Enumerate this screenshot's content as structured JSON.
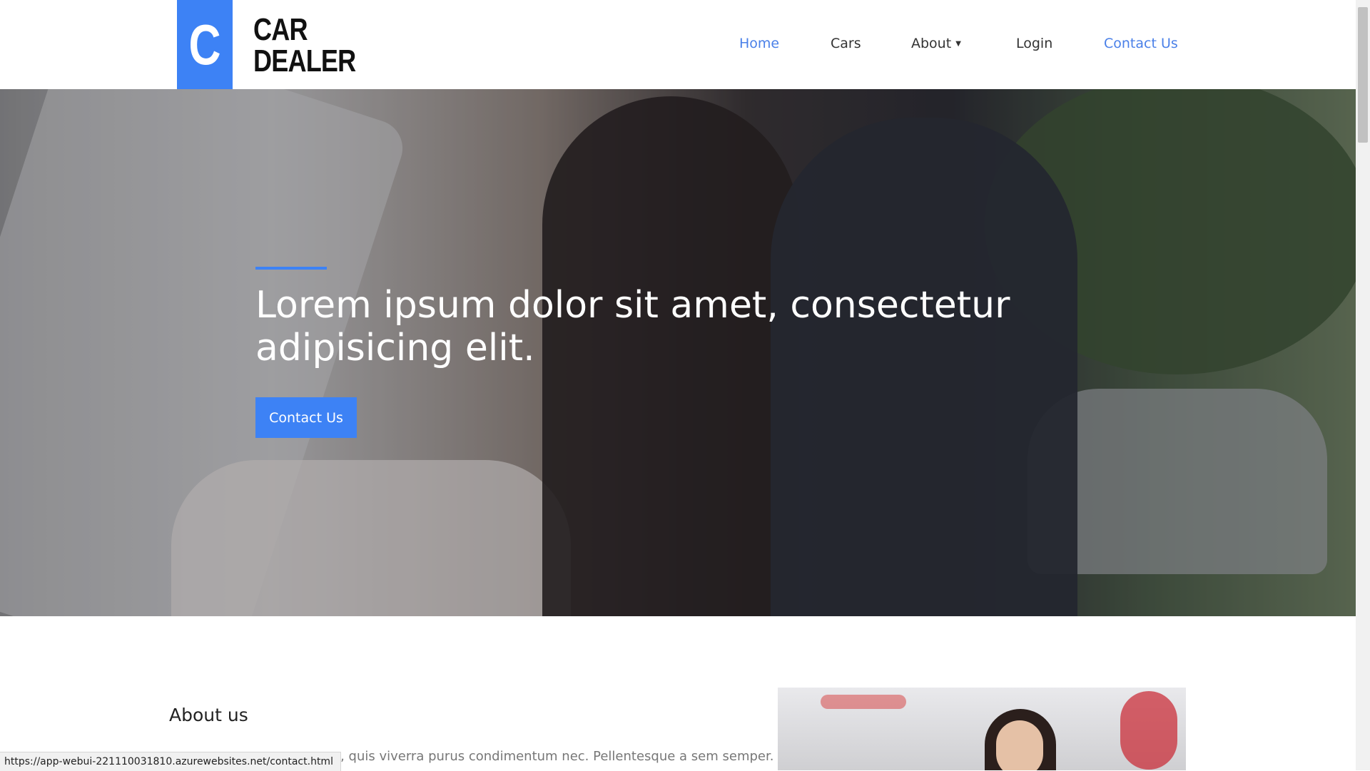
{
  "brand": {
    "logo_letter": "C",
    "name_line1": "CAR",
    "name_line2": "DEALER",
    "accent_color": "#3d82f5"
  },
  "nav": {
    "items": [
      {
        "label": "Home",
        "active": true
      },
      {
        "label": "Cars",
        "active": false
      },
      {
        "label": "About",
        "active": false,
        "has_dropdown": true
      },
      {
        "label": "Login",
        "active": false
      },
      {
        "label": "Contact Us",
        "active": true
      }
    ],
    "caret": "▼"
  },
  "hero": {
    "title": "Lorem ipsum dolor sit amet, consectetur adipisicing elit.",
    "cta_label": "Contact Us"
  },
  "about": {
    "title": "About us",
    "text": "eo, quis viverra purus condimentum nec. Pellentesque a sem semper."
  },
  "status_bar": {
    "url": "https://app-webui-221110031810.azurewebsites.net/contact.html"
  }
}
